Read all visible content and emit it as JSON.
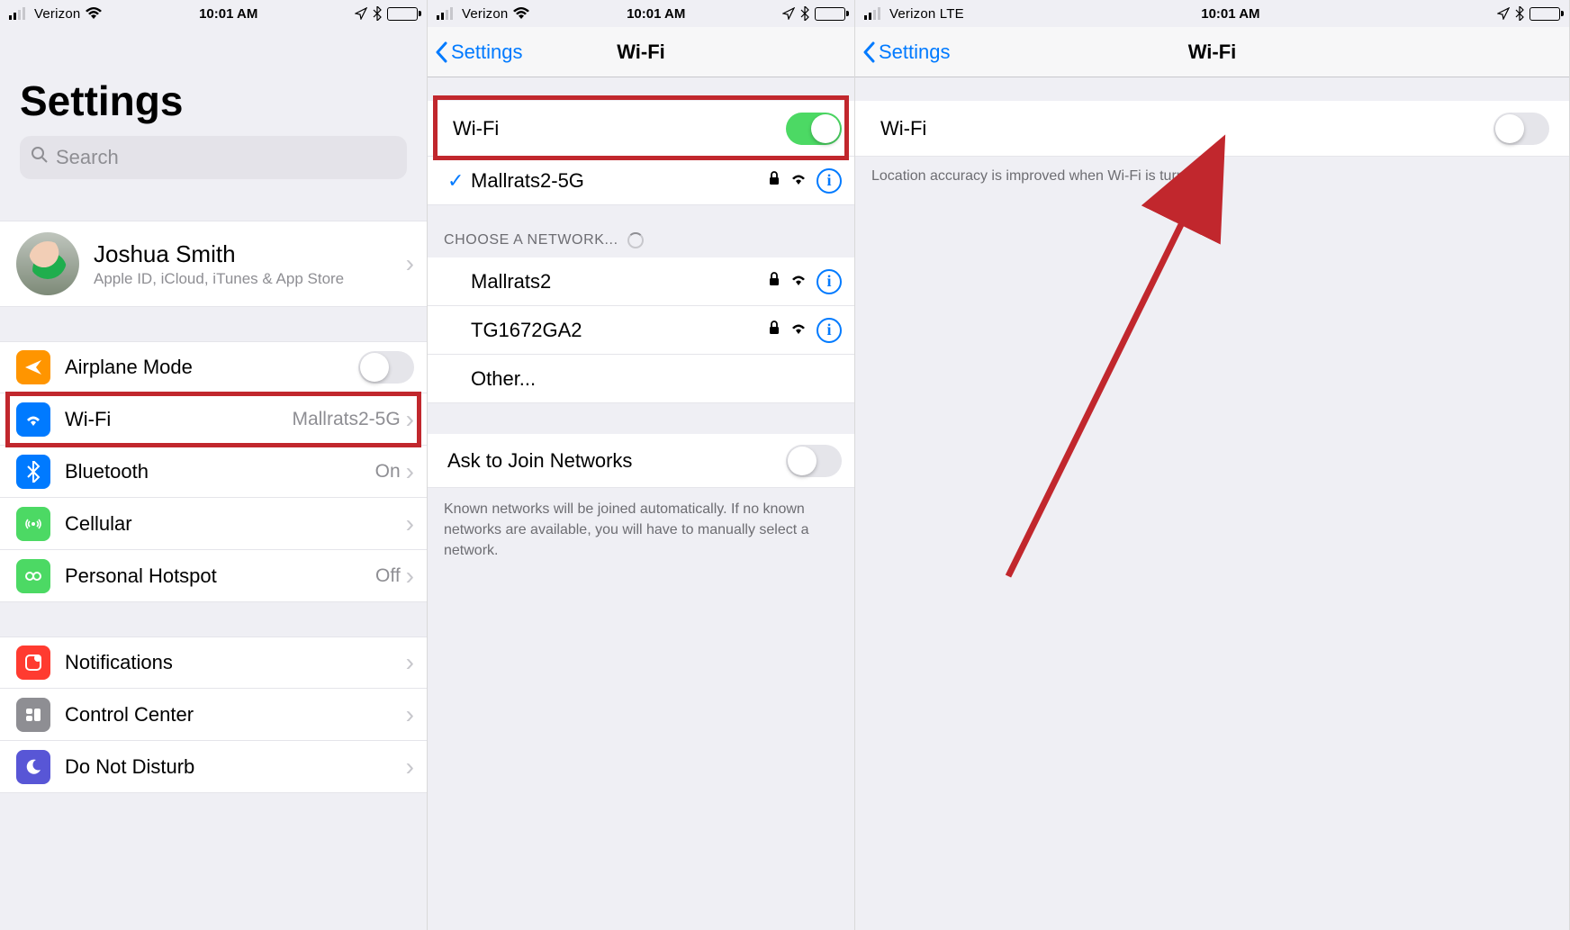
{
  "statusbar": {
    "carrier_wifi": "Verizon",
    "carrier_lte": "Verizon  LTE",
    "time": "10:01 AM"
  },
  "screen1": {
    "title": "Settings",
    "search_placeholder": "Search",
    "account": {
      "name": "Joshua Smith",
      "subtitle": "Apple ID, iCloud, iTunes & App Store"
    },
    "rows": {
      "airplane": "Airplane Mode",
      "wifi_label": "Wi-Fi",
      "wifi_value": "Mallrats2-5G",
      "bluetooth_label": "Bluetooth",
      "bluetooth_value": "On",
      "cellular": "Cellular",
      "hotspot_label": "Personal Hotspot",
      "hotspot_value": "Off",
      "notifications": "Notifications",
      "control_center": "Control Center",
      "dnd": "Do Not Disturb"
    }
  },
  "screen2": {
    "back": "Settings",
    "title": "Wi-Fi",
    "wifi_toggle_label": "Wi-Fi",
    "connected": "Mallrats2-5G",
    "choose_header": "CHOOSE A NETWORK...",
    "networks": {
      "n1": "Mallrats2",
      "n2": "TG1672GA2",
      "other": "Other..."
    },
    "ask_label": "Ask to Join Networks",
    "ask_footer": "Known networks will be joined automatically. If no known networks are available, you will have to manually select a network."
  },
  "screen3": {
    "back": "Settings",
    "title": "Wi-Fi",
    "wifi_toggle_label": "Wi-Fi",
    "footer": "Location accuracy is improved when Wi-Fi is turned on."
  }
}
